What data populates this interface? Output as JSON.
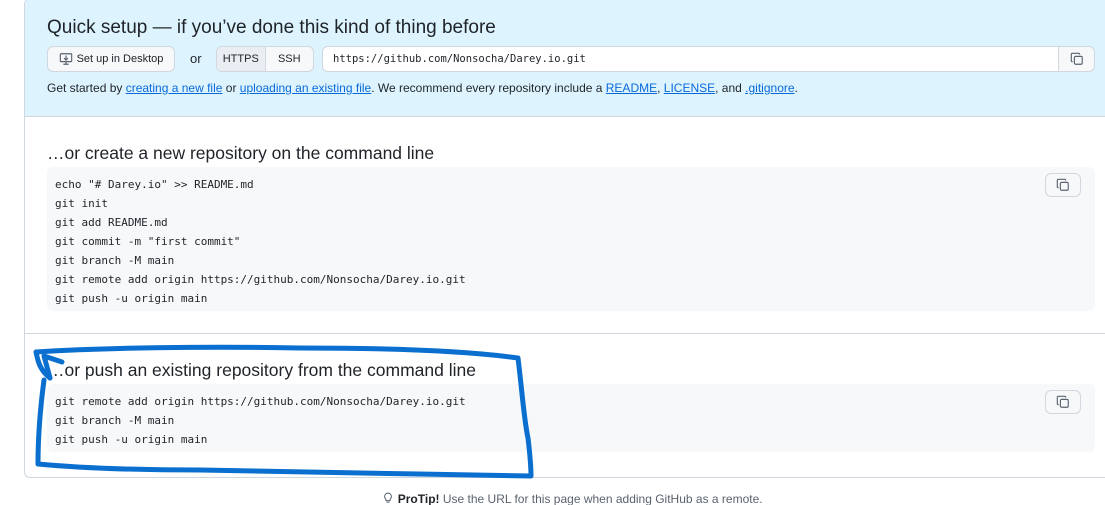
{
  "quick_setup": {
    "title": "Quick setup — if you’ve done this kind of thing before",
    "desktop_button": "Set up in Desktop",
    "or_label": "or",
    "protocols": [
      "HTTPS",
      "SSH"
    ],
    "active_protocol": "HTTPS",
    "clone_url": "https://github.com/Nonsocha/Darey.io.git",
    "hint": {
      "prefix": "Get started by ",
      "link_new_file": "creating a new file",
      "or": " or ",
      "link_upload": "uploading an existing file",
      "middle": ". We recommend every repository include a ",
      "link_readme": "README",
      "comma1": ", ",
      "link_license": "LICENSE",
      "and": ", and ",
      "link_gitignore": ".gitignore",
      "suffix": "."
    }
  },
  "new_repo": {
    "title": "…or create a new repository on the command line",
    "commands": [
      "echo \"# Darey.io\" >> README.md",
      "git init",
      "git add README.md",
      "git commit -m \"first commit\"",
      "git branch -M main",
      "git remote add origin https://github.com/Nonsocha/Darey.io.git",
      "git push -u origin main"
    ]
  },
  "push_existing": {
    "title": "…or push an existing repository from the command line",
    "commands": [
      "git remote add origin https://github.com/Nonsocha/Darey.io.git",
      "git branch -M main",
      "git push -u origin main"
    ]
  },
  "protip": {
    "label": "ProTip!",
    "text": " Use the URL for this page when adding GitHub as a remote."
  },
  "colors": {
    "accent_link": "#0969da",
    "quick_bg": "#ddf4ff",
    "annotation": "#0a6fce"
  },
  "icons": {
    "desktop": "desktop-download-icon",
    "copy": "copy-icon",
    "light_bulb": "light-bulb-icon"
  }
}
